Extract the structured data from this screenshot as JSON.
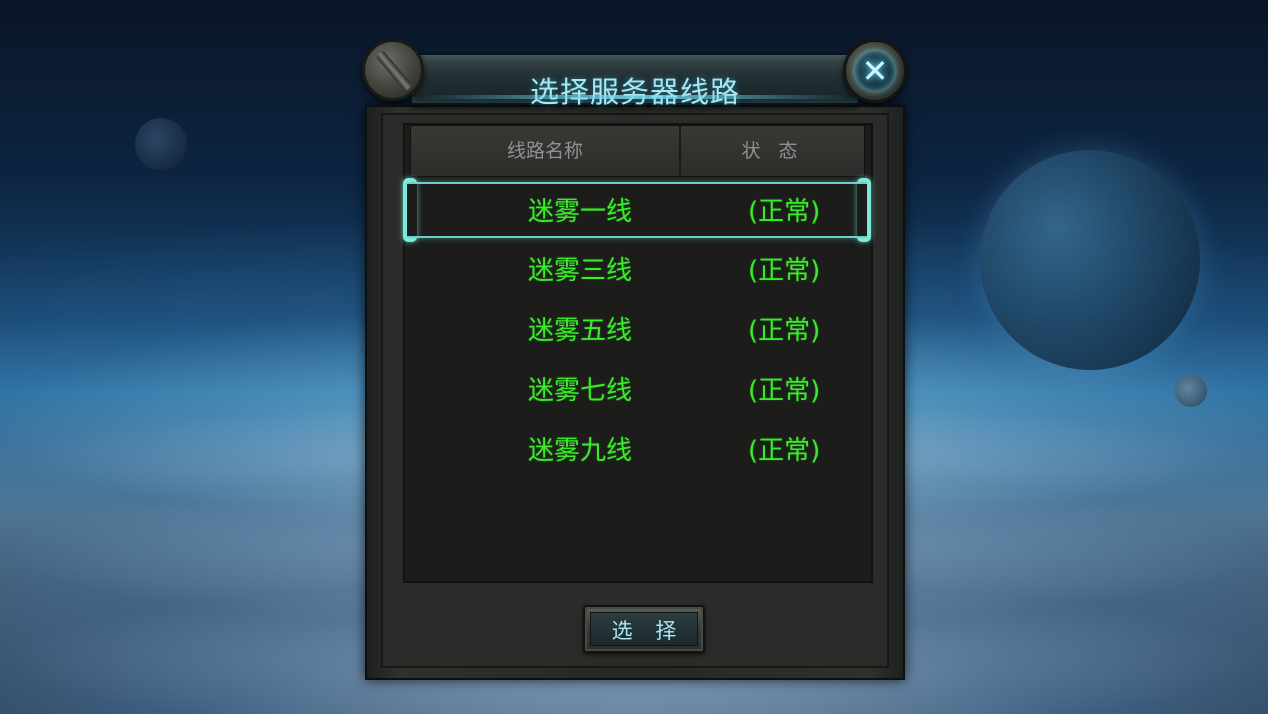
{
  "dialog": {
    "title": "选择服务器线路",
    "close_icon": "✕",
    "header": {
      "name_col": "线路名称",
      "status_col": "状 态"
    },
    "rows": [
      {
        "name": "迷雾一线",
        "status": "(正常)",
        "selected": true
      },
      {
        "name": "迷雾三线",
        "status": "(正常)",
        "selected": false
      },
      {
        "name": "迷雾五线",
        "status": "(正常)",
        "selected": false
      },
      {
        "name": "迷雾七线",
        "status": "(正常)",
        "selected": false
      },
      {
        "name": "迷雾九线",
        "status": "(正常)",
        "selected": false
      }
    ],
    "select_button": "选 择"
  },
  "colors": {
    "row_text": "#3bea2a",
    "title_text": "#a8e8f2",
    "selection": "#7fe8da"
  }
}
